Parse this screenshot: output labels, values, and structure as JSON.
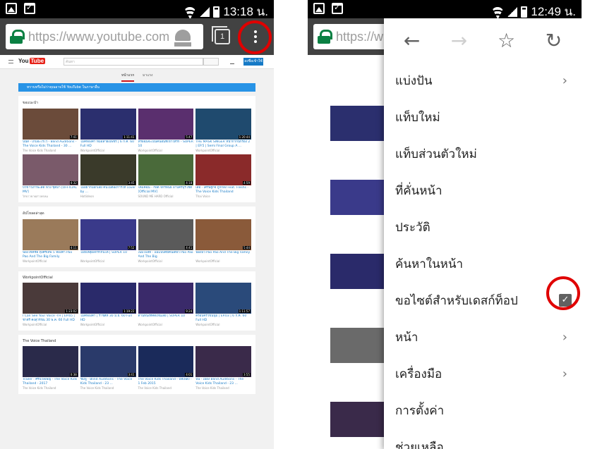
{
  "left": {
    "status": {
      "time": "13:18 น."
    },
    "address_bar": {
      "url": "https://www.youtube.com",
      "tab_count": "1"
    },
    "youtube": {
      "search_placeholder": "ค้นหา",
      "signin": "ลงชื่อเข้าใช้",
      "nav": [
        "หน้าแรก",
        "มาแรง"
      ],
      "banner": "ทราบหรือไม่ว่าคุณอาจใช้ YouTube ในภาษาอื่น",
      "sections": [
        {
          "title": "ขอแนะนำ",
          "videos": [
            {
              "title": "นนัส - เก็บอะไรไว้ - Blind Auditions - The Voice Kids Thailand - 30 ...",
              "meta": "The Voice Kids Thailand",
              "dur": "7:41",
              "color": "#6b4b3a"
            },
            {
              "title": "ไมค์ทองคำ หมอลำฝังเพชร | 6 ก.ค. 60 Full HD",
              "meta": "WorkpointOfficial",
              "dur": "1:11:41",
              "color": "#2b2f6e"
            },
            {
              "title": "หรือฉันจะเป็นคนอื่นที่เขาให้รัก - SUPER 10",
              "meta": "WorkpointOfficial",
              "dur": "5:47",
              "color": "#5a2f6e"
            },
            {
              "title": "THE MASK SINGER หน้ากากนักร้อง 2 | EP.5 | Semi Final Group A ...",
              "meta": "WorkpointOfficial",
              "dur": "1:20:44",
              "color": "#1f4a6e"
            },
            {
              "title": "บัวขาวเก้าพะลัด ฟวง ชุติมา [OFFICIAL MV]",
              "meta": "ไก่ขาวขายสาวพรหม",
              "dur": "4:32",
              "color": "#7a5a6a"
            },
            {
              "title": "ไม่อยากบอกเลย คนไม่ต้องการให้ cover by ...",
              "meta": "Hotlideon",
              "dur": "3:45",
              "color": "#3a3a2a"
            },
            {
              "title": "ได้แค่ฉัน - ก๊อต จักรพันธ์ อาบครบุรีโชติ [Official MV]",
              "meta": "SOUND ME HARD Official",
              "dur": "4:18",
              "color": "#4a6a3a"
            },
            {
              "title": "เสือ - เศรษฐกิจ ถูกกลิ้ง Feat. Fleshs - The Voice Kids Thailand",
              "meta": "Thai Voice",
              "dur": "4:59",
              "color": "#8a2a2a"
            }
          ]
        },
        {
          "title": "อัปโหลดล่าสุด",
          "videos": [
            {
              "title": "น้องโชคชัย ทุ่งศรีเทพ 5 ทองคำ Pao Pao And The Big Family",
              "meta": "WorkpointOfficial",
              "dur": "4:11",
              "color": "#9a7a5a"
            },
            {
              "title": "ไม่มีเหตุผลก็รักกันได้ | SUPER 10",
              "meta": "WorkpointOfficial",
              "dur": "7:52",
              "color": "#3a3a8a"
            },
            {
              "title": "เนมโบลิท - แม่แบบดีมีคนเดียว Pao Pao And The Big",
              "meta": "WorkpointOfficial",
              "dur": "4:41",
              "color": "#5a5a5a"
            },
            {
              "title": "น้องมิว Pao Pao And The Big Family",
              "meta": "WorkpointOfficial",
              "dur": "5:44",
              "color": "#8a5a3a"
            }
          ]
        },
        {
          "title": "WorkpointOfficial",
          "videos": [
            {
              "title": "I Can See Your Voice -TH | EP.65 | ชาตรี คงสุวรรณ 30 พ.ค. 60 Full HD",
              "meta": "WorkpointOfficial",
              "dur": "1:23:02",
              "color": "#4a3a3a"
            },
            {
              "title": "ไมค์ทองคำ | ราชสีห์ 30 มิ.ย. 60 Full HD",
              "meta": "WorkpointOfficial",
              "dur": "1:19:22",
              "color": "#2a2a6a"
            },
            {
              "title": "ด้านหนึ่งที่คิดเห็นเลย | SUPER 10",
              "meta": "WorkpointOfficial",
              "dur": "9:24",
              "color": "#3a2a6a"
            },
            {
              "title": "ครอบครัวขนนุ่ม | EP.03 | 6 ก.ค. 60 Full HD",
              "meta": "WorkpointOfficial",
              "dur": "1:11:57",
              "color": "#2a4a7a"
            }
          ]
        },
        {
          "title": "The Voice Thailand",
          "videos": [
            {
              "title": "Trailer : ศรีนวลเพ็ญ - The Voice Kids Thailand - 2017",
              "meta": "The Voice Kids Thailand",
              "dur": "0:38",
              "color": "#2a2a4a"
            },
            {
              "title": "ชมพู - Blind Auditions - The Voice Kids Thailand - 23 ...",
              "meta": "The Voice Kids Thailand",
              "dur": "3:41",
              "color": "#2a3a6a"
            },
            {
              "title": "The Voice Kids Thailand - บทเพลง - 1 Feb 2015",
              "meta": "The Voice Kids Thailand",
              "dur": "4:01",
              "color": "#1a2a5a"
            },
            {
              "title": "ปิ่น - เมือง Blind Auditions - The Voice Kids Thailand - 23 ...",
              "meta": "The Voice Kids Thailand",
              "dur": "3:55",
              "color": "#3a2a4a"
            }
          ]
        }
      ]
    }
  },
  "right": {
    "status": {
      "time": "12:49 น."
    },
    "address_bar": {
      "url": "https://w"
    },
    "menu": {
      "icons": [
        "back-icon",
        "forward-icon",
        "star-icon",
        "refresh-icon"
      ],
      "items": [
        {
          "label": "แบ่งปัน",
          "chevron": true
        },
        {
          "label": "แท็บใหม่"
        },
        {
          "label": "แท็บส่วนตัวใหม่"
        },
        {
          "label": "ที่คั่นหน้า"
        },
        {
          "label": "ประวัติ"
        },
        {
          "label": "ค้นหาในหน้า"
        },
        {
          "label": "ขอไซต์สำหรับเดสก์ท็อป",
          "checkbox": true
        },
        {
          "label": "หน้า",
          "chevron": true
        },
        {
          "label": "เครื่องมือ",
          "chevron": true
        },
        {
          "label": "การตั้งค่า"
        },
        {
          "label": "ช่วยเหลือ"
        }
      ]
    }
  },
  "colors": {
    "highlight_circle": "#e00000",
    "chrome_bar": "#424242",
    "youtube_red": "#e62117"
  }
}
